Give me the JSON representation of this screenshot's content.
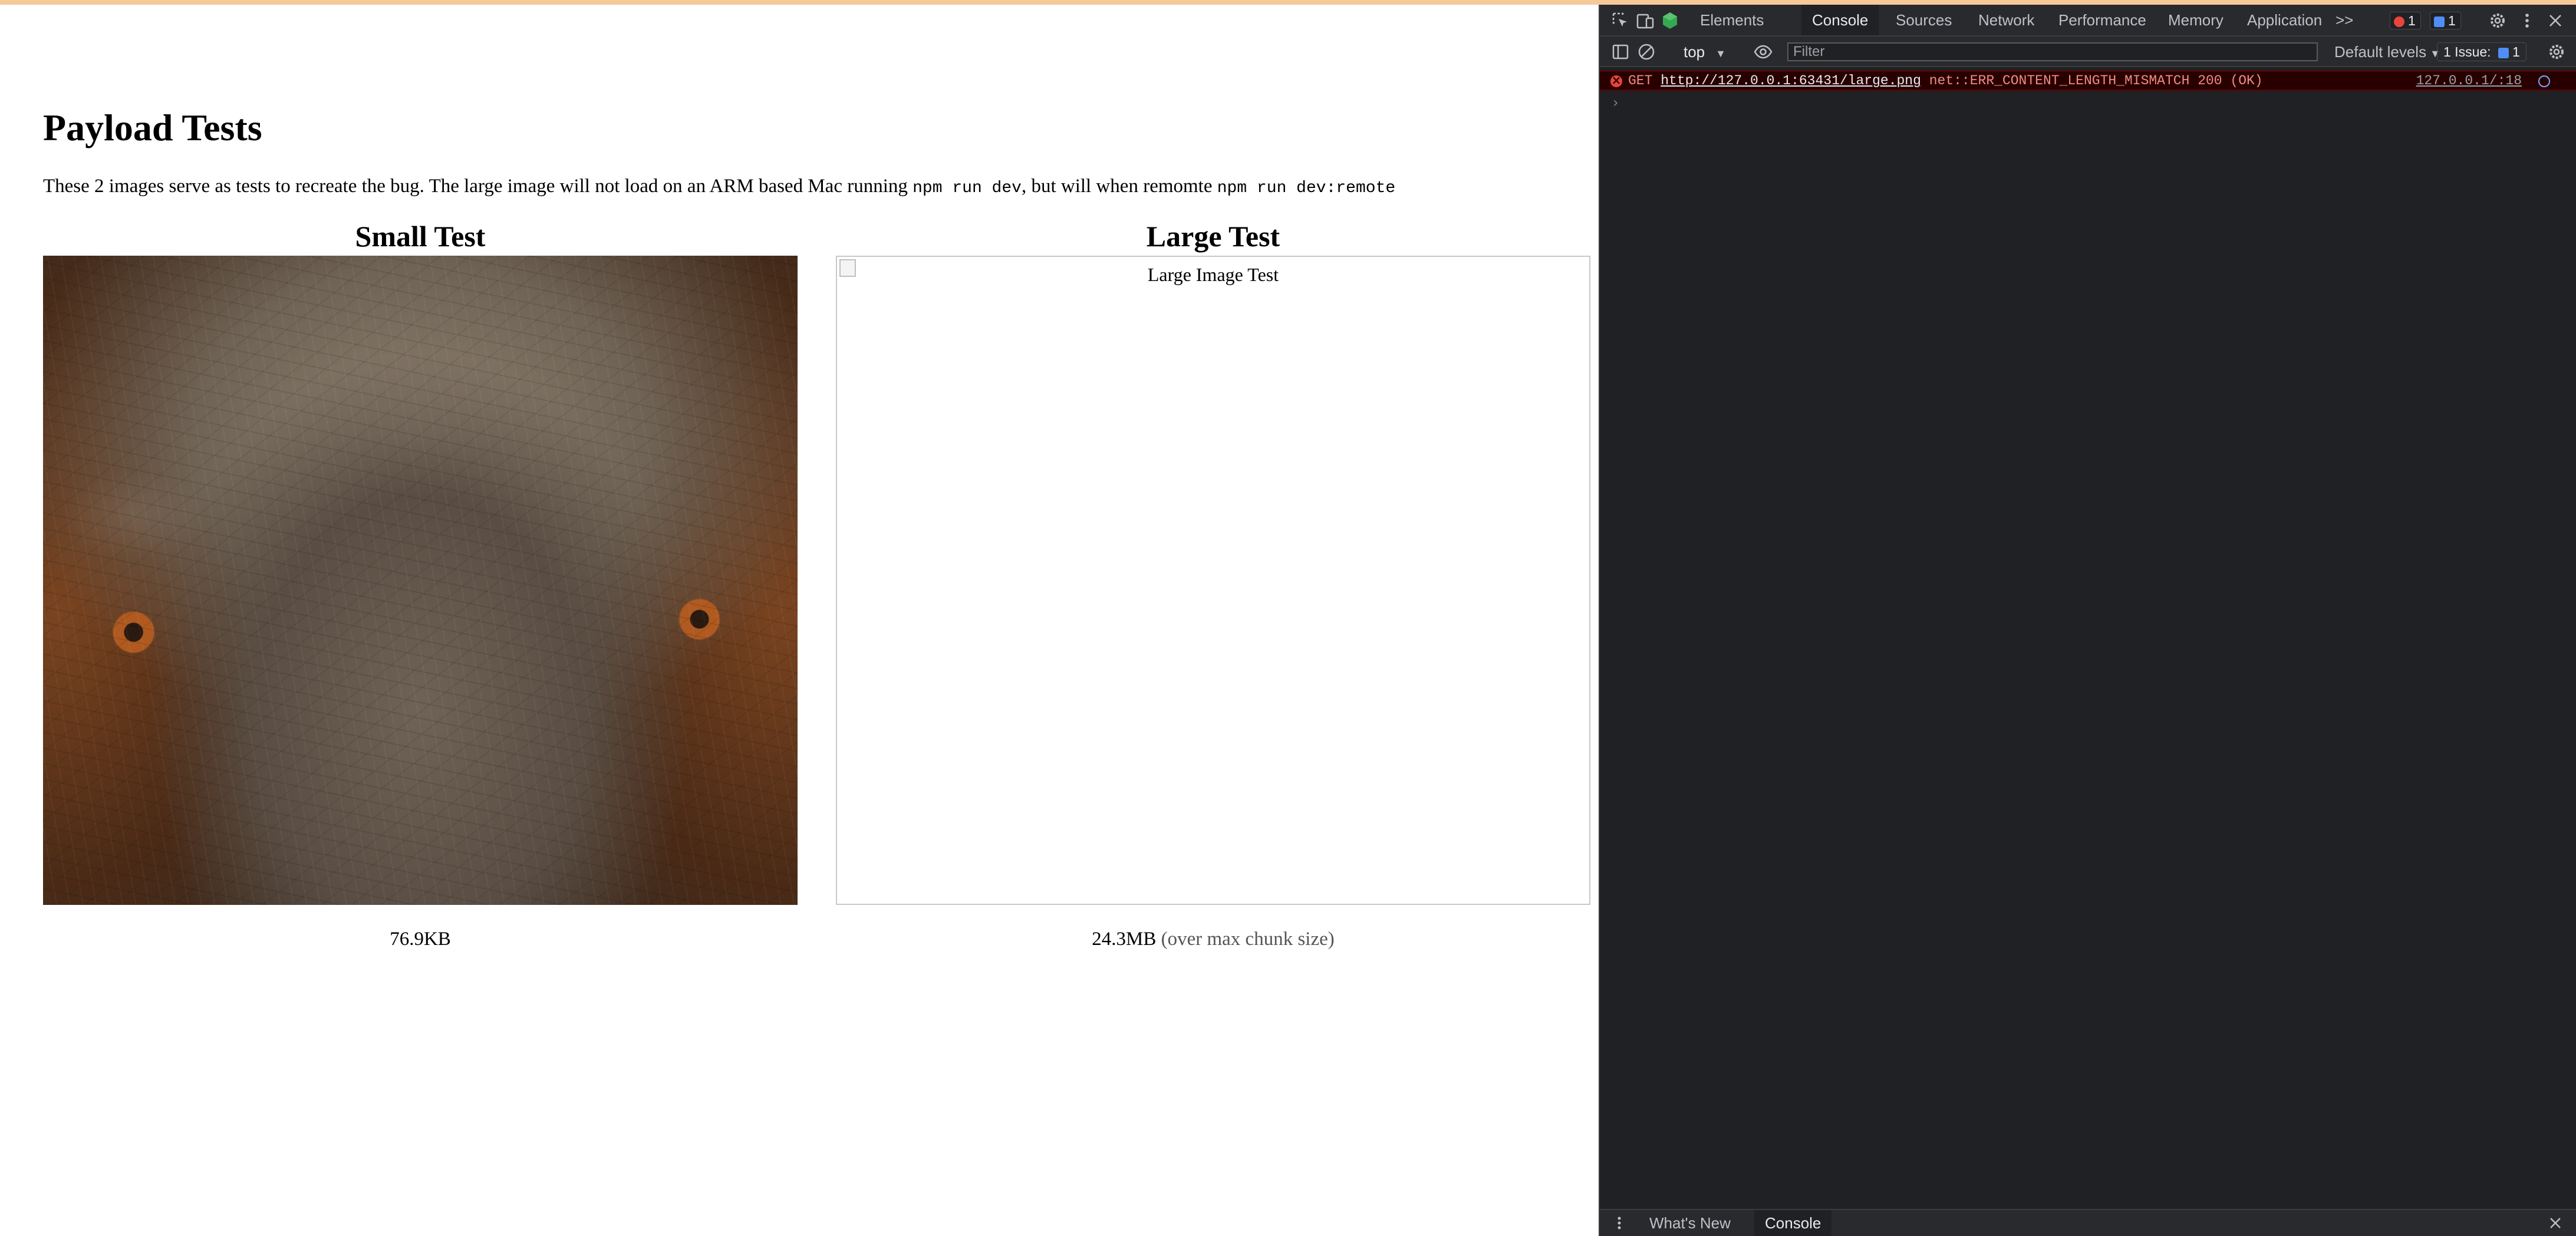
{
  "page": {
    "title": "Payload Tests",
    "intro": {
      "text1": "These 2 images serve as tests to recreate the bug. The large image will not load on an ARM based Mac running ",
      "code1": "npm run dev",
      "text2": ", but will when remomte ",
      "code2": "npm run dev:remote"
    },
    "small": {
      "heading": "Small Test",
      "size": "76.9KB"
    },
    "large": {
      "heading": "Large Test",
      "alt": "Large Image Test",
      "size": "24.3MB",
      "note": "(over max chunk size)"
    }
  },
  "devtools": {
    "tabs": [
      "Elements",
      "Console",
      "Sources",
      "Network",
      "Performance",
      "Memory",
      "Application"
    ],
    "active_tab": "Console",
    "more": ">>",
    "error_count": "1",
    "message_count": "1",
    "toolbar": {
      "context": "top",
      "filter_placeholder": "Filter",
      "levels": "Default levels",
      "issues_label": "1 Issue:",
      "issues_count": "1"
    },
    "console": {
      "error": {
        "method": "GET",
        "url": "http://127.0.0.1:63431/large.png",
        "message": "net::ERR_CONTENT_LENGTH_MISMATCH 200 (OK)",
        "source": "127.0.0.1/:18"
      },
      "prompt": "›"
    },
    "drawer": {
      "tabs": [
        "What's New",
        "Console"
      ],
      "active": "Console"
    }
  },
  "colors": {
    "error_text": "#f28b82",
    "error_bg": "#290000",
    "devtools_bg": "#202124",
    "error_icon": "#e8453c",
    "info_icon": "#4f8ef7"
  },
  "icons": [
    "inspect-icon",
    "device-toolbar-icon",
    "extension-icon",
    "error-icon",
    "message-icon",
    "settings-icon",
    "more-vert-icon",
    "close-icon",
    "sidebar-icon",
    "clear-console-icon",
    "eye-icon",
    "settings-gear-icon",
    "link-icon",
    "drawer-menu-icon"
  ]
}
